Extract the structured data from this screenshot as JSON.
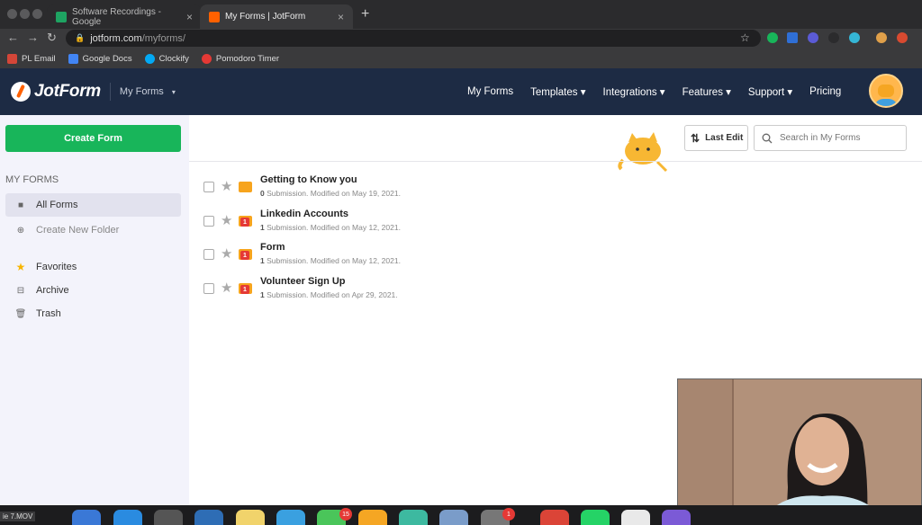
{
  "browser": {
    "tabs": [
      {
        "title": "Software Recordings - Google",
        "favicon_color": "#1ea362"
      },
      {
        "title": "My Forms | JotForm",
        "favicon_color": "#ff6100"
      }
    ],
    "address": {
      "domain": "jotform.com",
      "path": "/myforms/"
    },
    "bookmarks": [
      {
        "label": "PL Email",
        "color": "#d44638"
      },
      {
        "label": "Google Docs",
        "color": "#4285f4"
      },
      {
        "label": "Clockify",
        "color": "#03a9f4"
      },
      {
        "label": "Pomodoro Timer",
        "color": "#e53935"
      }
    ]
  },
  "app": {
    "logo_text": "JotForm",
    "section_dropdown": "My Forms",
    "nav": [
      "My Forms",
      "Templates ▾",
      "Integrations ▾",
      "Features ▾",
      "Support ▾",
      "Pricing"
    ]
  },
  "sidebar": {
    "create_label": "Create Form",
    "title": "MY FORMS",
    "items": [
      {
        "label": "All Forms",
        "icon": "folder-icon"
      },
      {
        "label": "Create New Folder",
        "icon": "plus-circle-icon"
      },
      {
        "label": "Favorites",
        "icon": "star-icon"
      },
      {
        "label": "Archive",
        "icon": "archive-icon"
      },
      {
        "label": "Trash",
        "icon": "trash-icon"
      }
    ]
  },
  "toolbar": {
    "sort_label": "Last Edit",
    "search_placeholder": "Search in My Forms"
  },
  "forms": [
    {
      "title": "Getting to Know you",
      "count": "0",
      "meta": " Submission. Modified on May 19, 2021.",
      "badge": ""
    },
    {
      "title": "Linkedin Accounts",
      "count": "1",
      "meta": " Submission. Modified on May 12, 2021.",
      "badge": "1"
    },
    {
      "title": "Form",
      "count": "1",
      "meta": " Submission. Modified on May 12, 2021.",
      "badge": "1"
    },
    {
      "title": "Volunteer Sign Up",
      "count": "1",
      "meta": " Submission. Modified on Apr 29, 2021.",
      "badge": "1"
    }
  ],
  "dock": {
    "file_label": "ie 7.MOV",
    "badges": [
      "15",
      "1"
    ]
  }
}
